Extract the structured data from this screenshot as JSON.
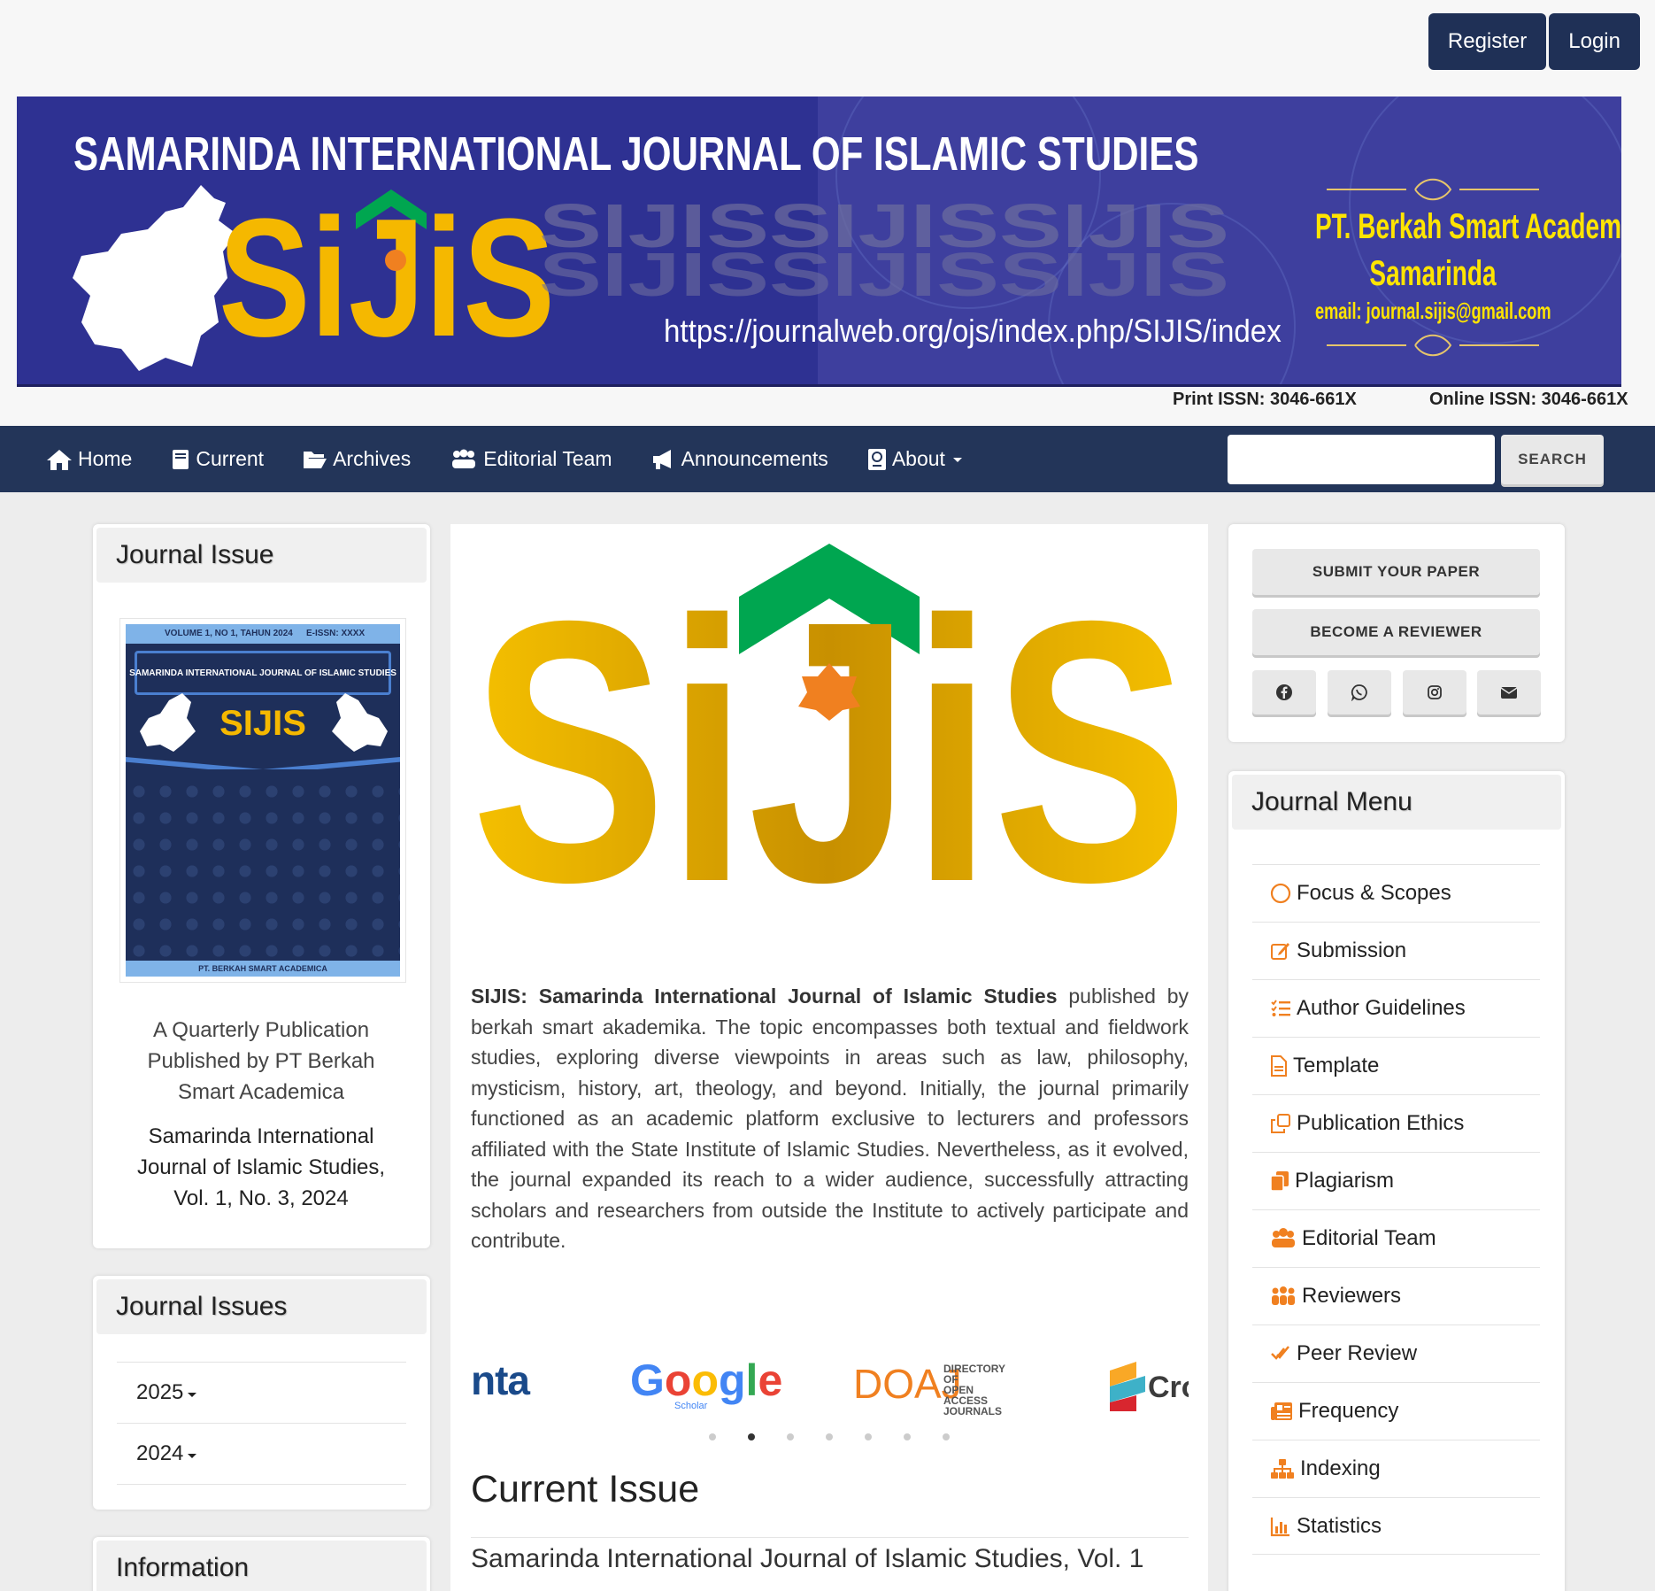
{
  "auth": {
    "register": "Register",
    "login": "Login"
  },
  "banner": {
    "title": "SAMARINDA INTERNATIONAL JOURNAL OF ISLAMIC STUDIES",
    "logo": "SIJIS",
    "url": "https://journalweb.org/ojs/index.php/SIJIS/index",
    "publisher": "PT. Berkah Smart Academica",
    "city": "Samarinda",
    "email": "email: journal.sijis@gmail.com"
  },
  "issn": {
    "print": "Print ISSN: 3046-661X",
    "online": "Online ISSN: 3046-661X"
  },
  "nav": [
    {
      "label": "Home",
      "icon": "home-icon"
    },
    {
      "label": "Current",
      "icon": "book-icon"
    },
    {
      "label": "Archives",
      "icon": "folder-open-icon"
    },
    {
      "label": "Editorial Team",
      "icon": "users-icon"
    },
    {
      "label": "Announcements",
      "icon": "bullhorn-icon"
    },
    {
      "label": "About",
      "icon": "passport-icon"
    }
  ],
  "search": {
    "button": "SEARCH",
    "placeholder": ""
  },
  "left": {
    "journal_issue": {
      "title": "Journal Issue",
      "cover": {
        "volume": "VOLUME 1, NO 1, TAHUN 2024",
        "eissn": "E-ISSN: XXXX",
        "title": "SAMARINDA INTERNATIONAL JOURNAL OF ISLAMIC STUDIES",
        "logo": "SIJIS",
        "footer": "PT. BERKAH SMART ACADEMICA"
      },
      "caption": "A Quarterly Publication Published by PT Berkah Smart Academica",
      "issue": "Samarinda International Journal of Islamic Studies, Vol. 1, No. 3, 2024"
    },
    "journal_issues": {
      "title": "Journal Issues",
      "years": [
        "2025",
        "2024"
      ]
    },
    "information": {
      "title": "Information"
    }
  },
  "main": {
    "logo": "SIJIS",
    "description_bold": "SIJIS: Samarinda International Journal of Islamic Studies",
    "description_rest": " published by berkah smart akademika. The topic encompasses both textual and fieldwork studies, exploring diverse viewpoints in areas such as law, philosophy, mysticism, history, art, theology, and beyond. Initially, the journal primarily functioned as an academic platform exclusive to lecturers and professors affiliated with the State Institute of Islamic Studies. Nevertheless, as it evolved, the journal expanded its reach to a wider audience, successfully attracting scholars and researchers from outside the Institute to actively participate and contribute.",
    "partners": [
      "nta",
      "Google",
      "DOAJ",
      "Cro"
    ],
    "partner_google_sub": "Scholar",
    "partner_doaj_sub": [
      "DIRECTORY OF",
      "OPEN ACCESS",
      "JOURNALS"
    ],
    "carousel_active": 1,
    "carousel_count": 7,
    "current_issue_heading": "Current Issue",
    "current_issue_title": "Samarinda International Journal of Islamic Studies, Vol. 1"
  },
  "right": {
    "submit": "SUBMIT YOUR PAPER",
    "reviewer": "BECOME A REVIEWER",
    "social": [
      "facebook-icon",
      "whatsapp-icon",
      "instagram-icon",
      "envelope-icon"
    ],
    "menu_title": "Journal Menu",
    "menu": [
      {
        "label": "Focus & Scopes",
        "icon": "circle-icon"
      },
      {
        "label": "Submission",
        "icon": "edit-icon"
      },
      {
        "label": "Author Guidelines",
        "icon": "list-check-icon"
      },
      {
        "label": "Template",
        "icon": "file-icon"
      },
      {
        "label": "Publication Ethics",
        "icon": "clone-icon"
      },
      {
        "label": "Plagiarism",
        "icon": "copy-icon"
      },
      {
        "label": "Editorial Team",
        "icon": "users-icon"
      },
      {
        "label": "Reviewers",
        "icon": "people-group-icon"
      },
      {
        "label": "Peer Review",
        "icon": "check-double-icon"
      },
      {
        "label": "Frequency",
        "icon": "newspaper-icon"
      },
      {
        "label": "Indexing",
        "icon": "sitemap-icon"
      },
      {
        "label": "Statistics",
        "icon": "chart-icon"
      }
    ]
  },
  "colors": {
    "navy": "#233559",
    "accent": "#f08020",
    "banner": "#2e3192",
    "gold": "#f5b800",
    "green": "#00a650"
  }
}
